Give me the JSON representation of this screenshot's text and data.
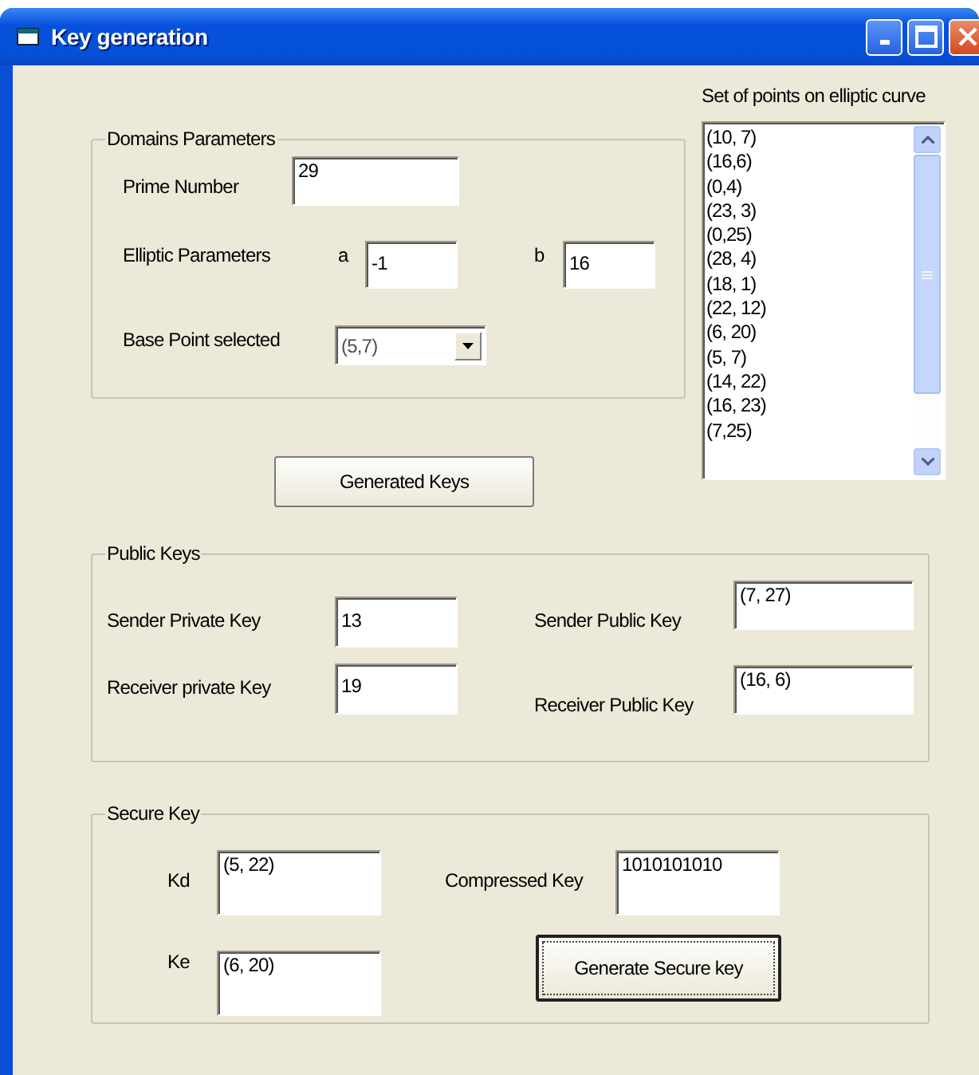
{
  "window": {
    "title": "Key generation"
  },
  "domain_parameters": {
    "title": "Domains Parameters",
    "prime_number": {
      "label": "Prime Number",
      "value": "29"
    },
    "elliptic_parameters": {
      "label": "Elliptic Parameters",
      "a": {
        "label": "a",
        "value": "-1"
      },
      "b": {
        "label": "b",
        "value": "16"
      }
    },
    "base_point": {
      "label": "Base Point selected",
      "value": "(5,7)"
    }
  },
  "points_list": {
    "label": "Set of points on elliptic curve",
    "items": [
      "(10, 7)",
      "(16,6)",
      "(0,4)",
      "(23, 3)",
      "(0,25)",
      "(28, 4)",
      "(18, 1)",
      "(22, 12)",
      "(6, 20)",
      "(5, 7)",
      "(14, 22)",
      "(16, 23)",
      "(7,25)"
    ]
  },
  "generate_keys_button": {
    "label": "Generated Keys",
    "focused": false
  },
  "public_keys": {
    "title": "Public Keys",
    "sender_private_key": {
      "label": "Sender Private Key",
      "value": "13"
    },
    "receiver_private_key": {
      "label": "Receiver private Key",
      "value": "19"
    },
    "sender_public_key": {
      "label": "Sender Public Key",
      "value": "(7, 27)"
    },
    "receiver_public_key": {
      "label": "Receiver Public Key",
      "value": "(16, 6)"
    }
  },
  "secure_key": {
    "title": "Secure Key",
    "kd": {
      "label": "Kd",
      "value": "(5, 22)"
    },
    "ke": {
      "label": "Ke",
      "value": "(6, 20)"
    },
    "compressed_key": {
      "label": "Compressed Key",
      "value": "1010101010"
    },
    "button": {
      "label": "Generate Secure key",
      "focused": true
    }
  }
}
